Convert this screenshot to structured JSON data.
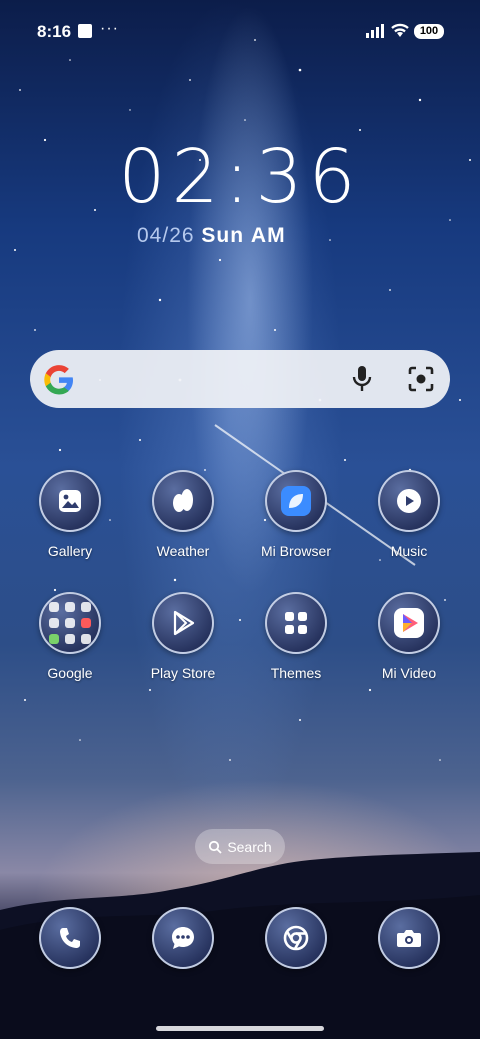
{
  "status_bar": {
    "time": "8:16",
    "more": "···",
    "battery": "100"
  },
  "clock": {
    "time": "02:36",
    "date": "04/26",
    "weekday": "Sun",
    "ampm": "AM"
  },
  "search_widget": {
    "google_icon": "google-g-icon",
    "mic_icon": "mic-icon",
    "lens_icon": "lens-icon"
  },
  "apps_row1": [
    {
      "label": "Gallery",
      "icon": "gallery-icon"
    },
    {
      "label": "Weather",
      "icon": "weather-icon"
    },
    {
      "label": "Mi Browser",
      "icon": "browser-icon"
    },
    {
      "label": "Music",
      "icon": "music-icon"
    }
  ],
  "apps_row2": [
    {
      "label": "Google",
      "icon": "folder-icon"
    },
    {
      "label": "Play Store",
      "icon": "play-store-icon"
    },
    {
      "label": "Themes",
      "icon": "themes-icon"
    },
    {
      "label": "Mi Video",
      "icon": "video-icon"
    }
  ],
  "app_search": {
    "label": "Search"
  },
  "dock": [
    {
      "name": "phone",
      "icon": "phone-icon"
    },
    {
      "name": "messages",
      "icon": "messages-icon"
    },
    {
      "name": "chrome",
      "icon": "chrome-icon"
    },
    {
      "name": "camera",
      "icon": "camera-icon"
    }
  ],
  "colors": {
    "google_blue": "#4285F4",
    "google_red": "#EA4335",
    "google_yellow": "#FBBC05",
    "google_green": "#34A853",
    "browser_blue": "#3b8cff"
  }
}
